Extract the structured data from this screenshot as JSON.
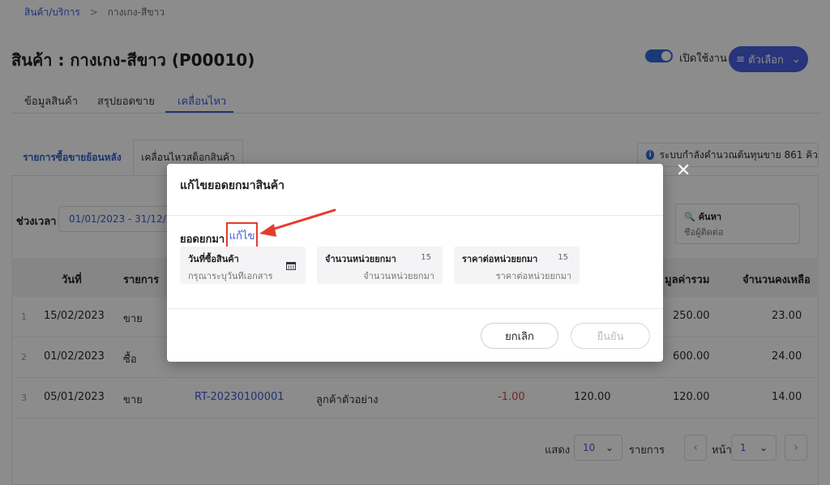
{
  "breadcrumb": {
    "parent": "สินค้า/บริการ",
    "separator": ">",
    "current": "กางเกง-สีขาว"
  },
  "page_title": "สินค้า : กางเกง-สีขาว (P00010)",
  "toggle_label": "เปิดใช้งาน",
  "options_button": "ตัวเลือก",
  "main_tabs": [
    "ข้อมูลสินค้า",
    "สรุปยอดขาย",
    "เคลื่อนไหว"
  ],
  "sub_tabs": [
    "รายการซื้อขายย้อนหลัง",
    "เคลื่อนไหวสต็อกสินค้า"
  ],
  "info_text": "ระบบกำลังคำนวณต้นทุนขาย 861 คิว",
  "filter": {
    "label": "ช่วงเวลา",
    "date_range": "01/01/2023 - 31/12/2023"
  },
  "search": {
    "title": "ค้นหา",
    "placeholder": "ชื่อผู้ติดต่อ"
  },
  "table": {
    "headers": [
      "วันที่",
      "รายการ",
      "มูลค่ารวม",
      "จำนวนคงเหลือ"
    ],
    "rows": [
      {
        "index": "1",
        "date": "15/02/2023",
        "type": "ขาย",
        "doc": "",
        "contact": "",
        "qty": "",
        "price": "",
        "total": "250.00",
        "balance": "23.00"
      },
      {
        "index": "2",
        "date": "01/02/2023",
        "type": "ซื้อ",
        "doc": "",
        "contact": "",
        "qty": "",
        "price": "",
        "total": "600.00",
        "balance": "24.00"
      },
      {
        "index": "3",
        "date": "05/01/2023",
        "type": "ขาย",
        "doc": "RT-20230100001",
        "contact": "ลูกค้าตัวอย่าง",
        "qty": "-1.00",
        "price": "120.00",
        "total": "120.00",
        "balance": "14.00"
      }
    ]
  },
  "pager": {
    "show_label": "แสดง",
    "page_size": "10",
    "items_label": "รายการ",
    "page_label": "หน้า",
    "page": "1"
  },
  "modal": {
    "title": "แก้ไขยอดยกมาสินค้า",
    "section_label": "ยอดยกมา",
    "edit_link": "แก้ไข",
    "fields": [
      {
        "label": "วันที่ซื้อสินค้า",
        "placeholder": "กรุณาระบุวันที่เอกสาร",
        "count": ""
      },
      {
        "label": "จำนวนหน่วยยกมา",
        "placeholder": "จำนวนหน่วยยกมา",
        "count": "15"
      },
      {
        "label": "ราคาต่อหน่วยยกมา",
        "placeholder": "ราคาต่อหน่วยยกมา",
        "count": "15"
      }
    ],
    "cancel_button": "ยกเลิก",
    "confirm_button": "ยืนยัน"
  },
  "colors": {
    "accent": "#3d5bd9",
    "button": "#4a5fe0",
    "highlight": "#e53c2e",
    "negative": "#d64545"
  },
  "icons": {
    "close": "close-icon",
    "calendar": "calendar-icon",
    "search": "search-icon",
    "info": "info-icon",
    "menu": "menu-icon",
    "chevron": "chevron-down-icon"
  }
}
